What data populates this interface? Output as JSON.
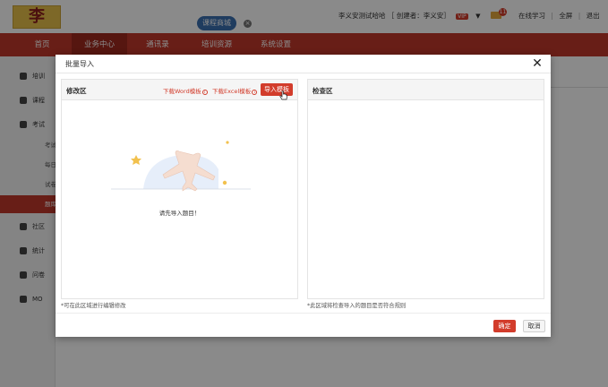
{
  "header": {
    "logo_text": "李",
    "mall_badge": "课程商城",
    "mall_close": "×",
    "user_name": "李义安测试哈哈",
    "creator": "［ 创建者：李义安］",
    "vip": "VIP",
    "message_count": "11",
    "links": [
      "在线学习",
      "全屏",
      "退出"
    ],
    "link_sep": "|"
  },
  "nav": {
    "items": [
      "首页",
      "业务中心",
      "通讯录",
      "培训资源",
      "系统设置"
    ],
    "active_index": 1
  },
  "sidebar": {
    "items": [
      "培训",
      "课程",
      "考试",
      "社区",
      "统计",
      "问卷",
      "MO"
    ],
    "sub_items": [
      "考试",
      "每日",
      "试卷",
      "题库"
    ]
  },
  "modal": {
    "title": "批量导入",
    "close_glyph": "✕",
    "edit_panel": {
      "title": "修改区",
      "download_word": "下载Word模板",
      "download_excel": "下载Excel模板",
      "info_glyph": "i",
      "import_button": "导入模板",
      "empty_text": "请先导入题目！"
    },
    "check_panel": {
      "title": "检查区"
    },
    "edit_hint": "*可在此区域进行编辑修改",
    "check_hint": "*此区域将检查导入的题目是否符合规则",
    "ok_button": "确定",
    "cancel_button": "取消"
  },
  "colors": {
    "brand_red": "#c0392b",
    "button_red": "#d23c2b",
    "plane": "#f5ddd0",
    "star": "#f2c14e"
  }
}
